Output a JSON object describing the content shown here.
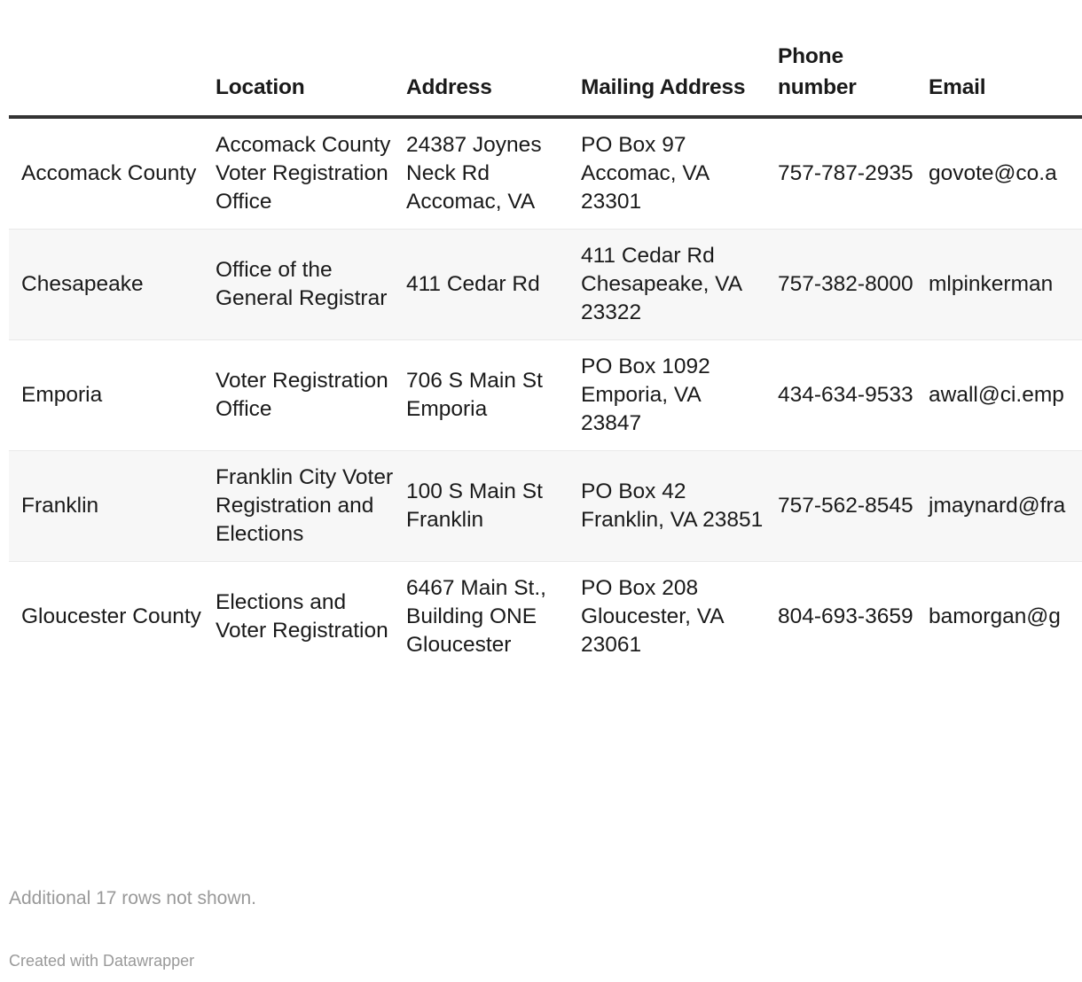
{
  "table": {
    "columns": [
      "",
      "Location",
      "Address",
      "Mailing Address",
      "Phone number",
      "Email"
    ],
    "headers": {
      "label": "",
      "location": "Location",
      "address": "Address",
      "mailing_address": "Mailing Address",
      "phone_number": "Phone number",
      "email": "Email"
    },
    "rows": [
      {
        "label": "Accomack County",
        "location": "Accomack County Voter Registration Office",
        "address": "24387 Joynes Neck Rd Accomac, VA",
        "mailing_address": "PO Box 97 Accomac, VA 23301",
        "phone_number": "757-787-2935",
        "email": "govote@co.a"
      },
      {
        "label": "Chesapeake",
        "location": "Office of the General Registrar",
        "address": "411 Cedar Rd",
        "mailing_address": "411 Cedar Rd Chesapeake, VA 23322",
        "phone_number": "757-382-8000",
        "email": "mlpinkerman"
      },
      {
        "label": "Emporia",
        "location": "Voter Registration Office",
        "address": "706 S Main St Emporia",
        "mailing_address": "PO Box 1092 Emporia, VA 23847",
        "phone_number": "434-634-9533",
        "email": "awall@ci.emp"
      },
      {
        "label": "Franklin",
        "location": "Franklin City Voter Registration and Elections",
        "address": "100 S Main St Franklin",
        "mailing_address": "PO Box 42 Franklin, VA 23851",
        "phone_number": "757-562-8545",
        "email": "jmaynard@fra"
      },
      {
        "label": "Gloucester County",
        "location": "Elections and Voter Registration",
        "address": "6467 Main St., Building ONE Gloucester",
        "mailing_address": "PO Box 208 Gloucester, VA 23061",
        "phone_number": "804-693-3659",
        "email": "bamorgan@g"
      }
    ]
  },
  "footnote": "Additional 17 rows not shown.",
  "credit": "Created with Datawrapper",
  "colors": {
    "header_rule": "#333333",
    "stripe_background": "#f7f7f7",
    "text": "#1a1a1a",
    "muted_text": "#999999"
  }
}
